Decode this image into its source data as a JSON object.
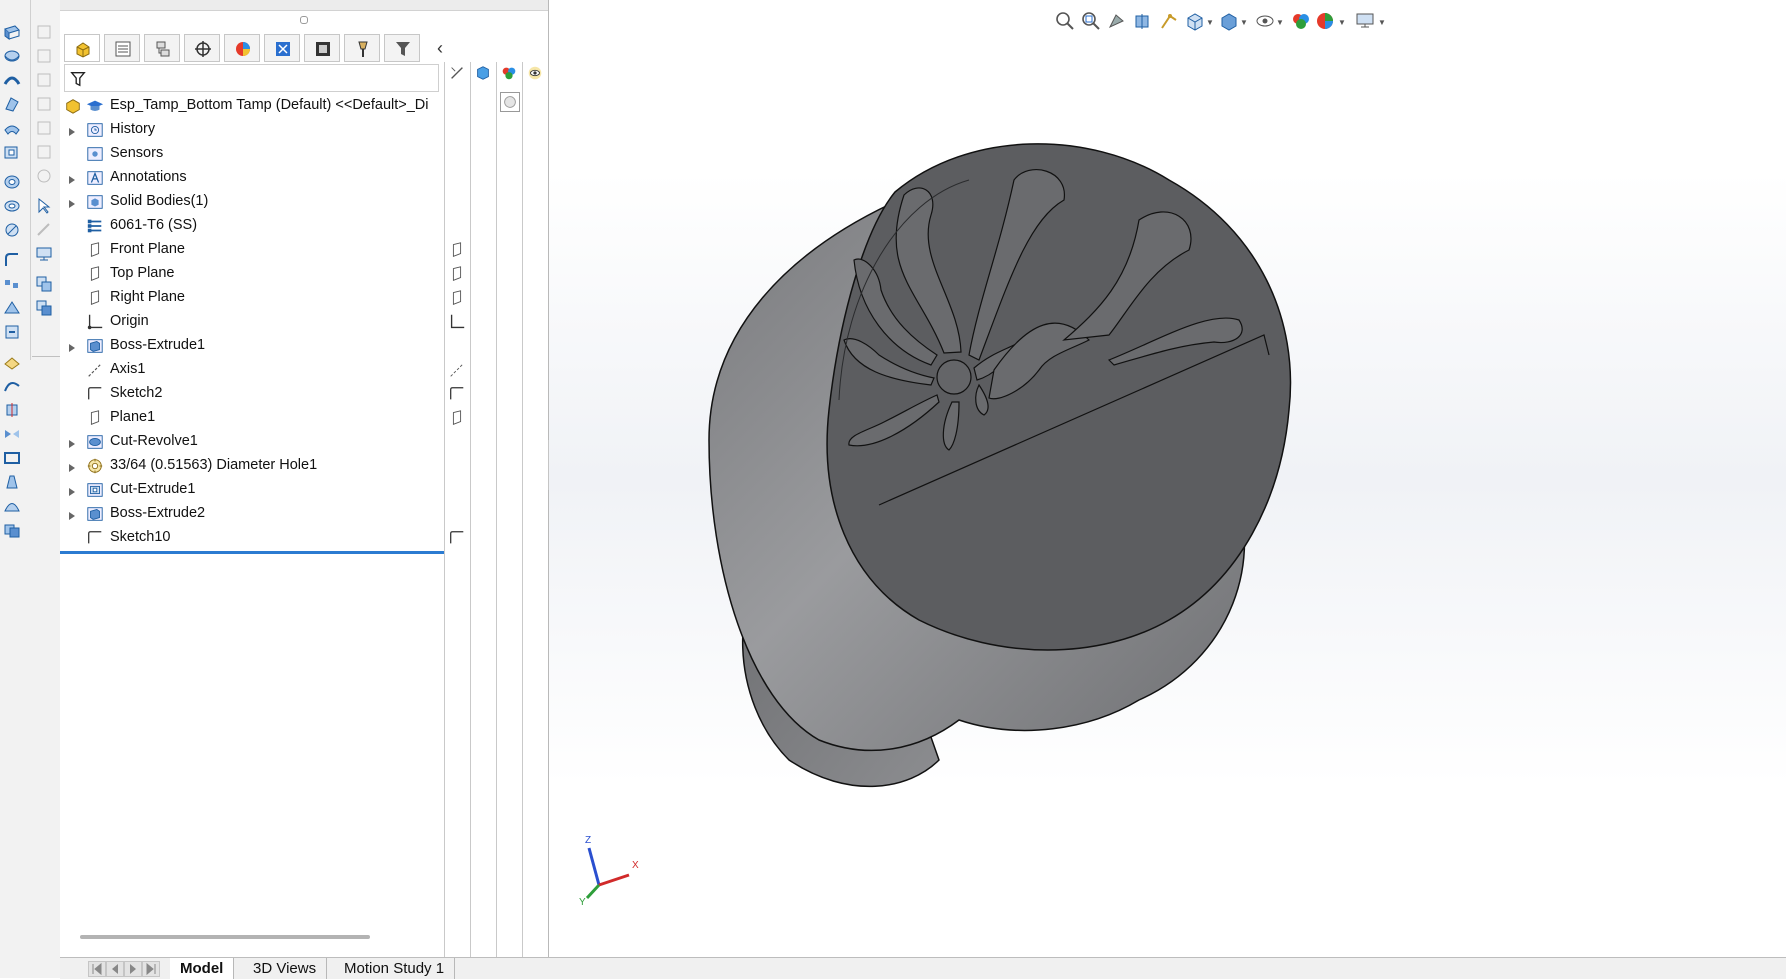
{
  "tree": {
    "root": "Esp_Tamp_Bottom Tamp (Default) <<Default>_Di",
    "items": [
      {
        "label": "History",
        "expandable": true,
        "icon": "history-icon"
      },
      {
        "label": "Sensors",
        "expandable": false,
        "icon": "sensors-icon"
      },
      {
        "label": "Annotations",
        "expandable": true,
        "icon": "annotations-icon"
      },
      {
        "label": "Solid Bodies(1)",
        "expandable": true,
        "icon": "solid-bodies-icon"
      },
      {
        "label": "6061-T6 (SS)",
        "expandable": false,
        "icon": "material-icon"
      },
      {
        "label": "Front Plane",
        "expandable": false,
        "icon": "plane-icon"
      },
      {
        "label": "Top Plane",
        "expandable": false,
        "icon": "plane-icon"
      },
      {
        "label": "Right Plane",
        "expandable": false,
        "icon": "plane-icon"
      },
      {
        "label": "Origin",
        "expandable": false,
        "icon": "origin-icon"
      },
      {
        "label": "Boss-Extrude1",
        "expandable": true,
        "icon": "extrude-icon"
      },
      {
        "label": "Axis1",
        "expandable": false,
        "icon": "axis-icon"
      },
      {
        "label": "Sketch2",
        "expandable": false,
        "icon": "sketch-icon"
      },
      {
        "label": "Plane1",
        "expandable": false,
        "icon": "plane-icon"
      },
      {
        "label": "Cut-Revolve1",
        "expandable": true,
        "icon": "revolve-icon"
      },
      {
        "label": "33/64 (0.51563) Diameter Hole1",
        "expandable": true,
        "icon": "hole-wizard-icon"
      },
      {
        "label": "Cut-Extrude1",
        "expandable": true,
        "icon": "cut-extrude-icon"
      },
      {
        "label": "Boss-Extrude2",
        "expandable": true,
        "icon": "extrude-icon"
      },
      {
        "label": "Sketch10",
        "expandable": false,
        "icon": "sketch-icon"
      }
    ]
  },
  "bottom_tabs": [
    "Model",
    "3D Views",
    "Motion Study 1"
  ],
  "active_bottom_tab": "Model",
  "triad": {
    "z": "Z",
    "x": "X",
    "y": "Y"
  },
  "colors": {
    "accent": "#2b7bd1",
    "part_face": "#5c5d60",
    "part_body": "#8a8b8e",
    "triad_x": "#d12a2a",
    "triad_y": "#2e9e3a",
    "triad_z": "#2a4fcf"
  }
}
